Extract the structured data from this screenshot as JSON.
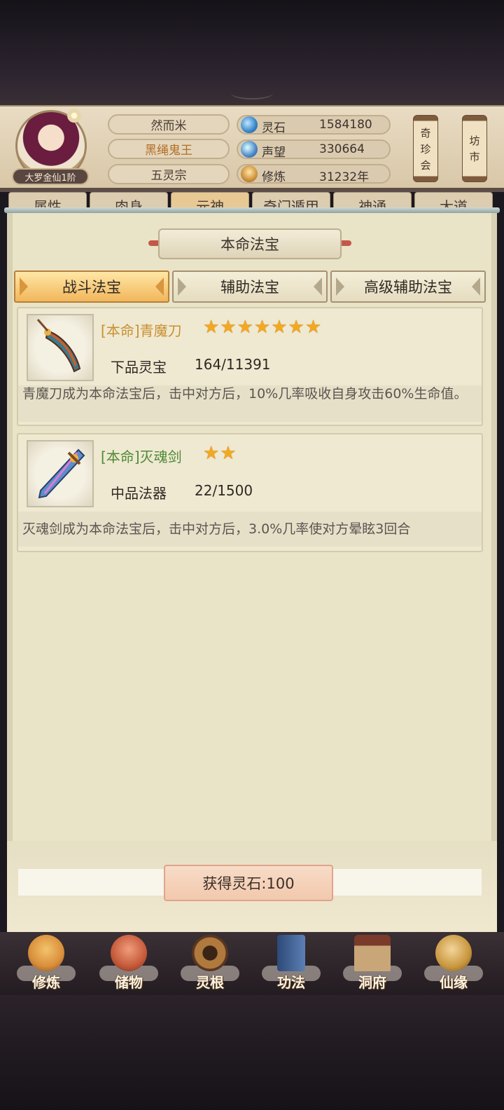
{
  "header": {
    "player_name": "然而米",
    "title": "黑绳鬼王",
    "sect": "五灵宗",
    "rank": "大罗金仙1阶",
    "stats": [
      {
        "label": "灵石",
        "value": "1584180",
        "icon": "spirit-stone-icon"
      },
      {
        "label": "声望",
        "value": "330664",
        "icon": "reputation-icon"
      },
      {
        "label": "修炼",
        "value": "31232年",
        "icon": "cultivation-icon"
      }
    ],
    "side_buttons": [
      {
        "chars": [
          "奇",
          "珍",
          "会"
        ]
      },
      {
        "chars": [
          "坊",
          "市"
        ]
      }
    ]
  },
  "tabs": [
    "属性",
    "肉身",
    "元神",
    "奇门遁甲",
    "神通",
    "大道"
  ],
  "panel": {
    "title": "本命法宝",
    "sub_tabs": [
      "战斗法宝",
      "辅助法宝",
      "高级辅助法宝"
    ],
    "items": [
      {
        "name": "[本命]青魔刀",
        "name_color": "#c9902f",
        "stars": "★★★★★★★",
        "grade": "下品灵宝",
        "progress": "164/11391",
        "desc": "青魔刀成为本命法宝后，击中对方后，10%几率吸收自身攻击60%生命值。"
      },
      {
        "name": "[本命]灭魂剑",
        "name_color": "#4f8a35",
        "stars": "★★",
        "grade": "中品法器",
        "progress": "22/1500",
        "desc": "灭魂剑成为本命法宝后，击中对方后，3.0%几率使对方晕眩3回合"
      }
    ],
    "reward_button": "获得灵石:100"
  },
  "nav": [
    {
      "label": "修炼",
      "icon": "cultivate-icon",
      "color": "#d98e3a"
    },
    {
      "label": "储物",
      "icon": "storage-bag-icon",
      "color": "#c45a3a"
    },
    {
      "label": "灵根",
      "icon": "spirit-root-icon",
      "color": "#7a4a2a"
    },
    {
      "label": "功法",
      "icon": "technique-book-icon",
      "color": "#3f5e8e"
    },
    {
      "label": "洞府",
      "icon": "cave-dwelling-icon",
      "color": "#8a6a48"
    },
    {
      "label": "仙缘",
      "icon": "immortal-fate-icon",
      "color": "#c8963e"
    }
  ]
}
